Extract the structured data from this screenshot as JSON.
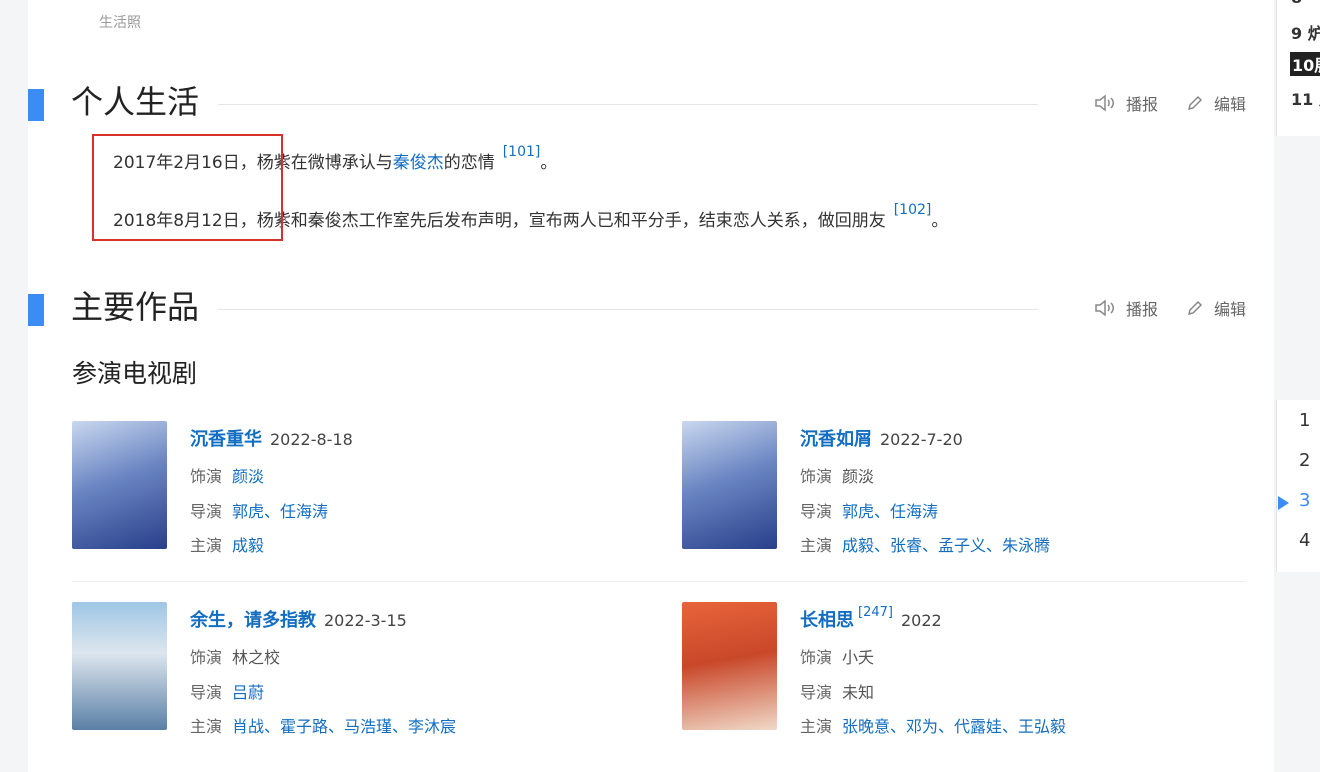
{
  "caption": "生活照",
  "actions": {
    "report": "播报",
    "edit": "编辑"
  },
  "sections": [
    {
      "title": "个人生活"
    },
    {
      "title": "主要作品"
    }
  ],
  "personal_life": [
    {
      "date": "2017年2月16日，",
      "text_a": "杨紫在微博承认与",
      "link": "秦俊杰",
      "text_b": "的恋情",
      "ref": "[101]",
      "end": "。"
    },
    {
      "date": "2018年8月12日，",
      "text_a": "杨紫和秦俊杰工作室先后发布声明，宣布两人已和平分手，结束恋人关系，做回朋友",
      "link": "",
      "text_b": "",
      "ref": "[102]",
      "end": "。"
    }
  ],
  "works_heading": "参演电视剧",
  "labels": {
    "role": "饰演",
    "director": "导演",
    "cast": "主演"
  },
  "works": [
    {
      "title": "沉香重华",
      "ref": "",
      "date": "2022-8-18",
      "role": "颜淡",
      "director": "郭虎、任海涛",
      "cast": "成毅"
    },
    {
      "title": "沉香如屑",
      "ref": "",
      "date": "2022-7-20",
      "role": "颜淡",
      "director": "郭虎、任海涛",
      "cast": "成毅、张睿、孟子义、朱泳腾"
    },
    {
      "title": "余生，请多指教",
      "ref": "",
      "date": "2022-3-15",
      "role": "林之校",
      "director": "吕蔚",
      "cast": "肖战、霍子路、马浩瑾、李沐宸"
    },
    {
      "title": "长相思",
      "ref": "[247]",
      "date": "2022",
      "role": "小夭",
      "director": "未知",
      "cast": "张晚意、邓为、代露娃、王弘毅"
    }
  ],
  "toc_top": [
    {
      "num": "9",
      "text": "炉"
    },
    {
      "num": "10",
      "text": "展"
    },
    {
      "num": "11",
      "text": "片"
    }
  ],
  "pagination": [
    "1",
    "2",
    "3",
    "4"
  ],
  "pagination_active": "3",
  "colors": {
    "accent": "#3b8cf5",
    "link": "#136ec2",
    "highlight_box": "#d9302a"
  }
}
